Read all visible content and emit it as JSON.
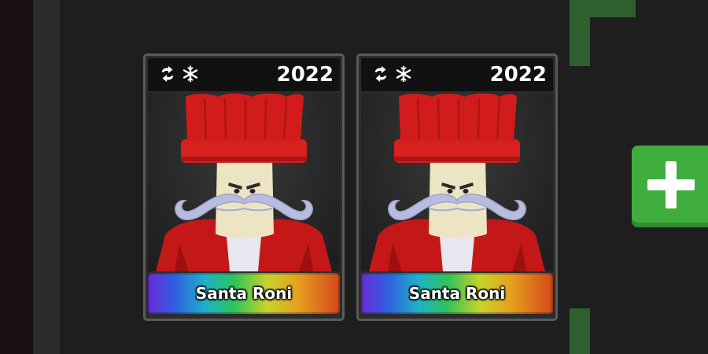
{
  "items": [
    {
      "year": "2022",
      "name": "Santa Roni",
      "header_icons": [
        "swap-arrows-icon",
        "snowflake-icon"
      ],
      "rarity_bar": "rainbow"
    },
    {
      "year": "2022",
      "name": "Santa Roni",
      "header_icons": [
        "swap-arrows-icon",
        "snowflake-icon"
      ],
      "rarity_bar": "rainbow"
    }
  ],
  "add_button": {
    "icon": "plus-icon",
    "color": "#3fae3f"
  },
  "colors": {
    "background": "#1e1e1e",
    "card_border": "#5a5a5a",
    "hat_red": "#d21c1c",
    "mustache": "#b8bde0",
    "accent_green": "#2e5f2e"
  }
}
